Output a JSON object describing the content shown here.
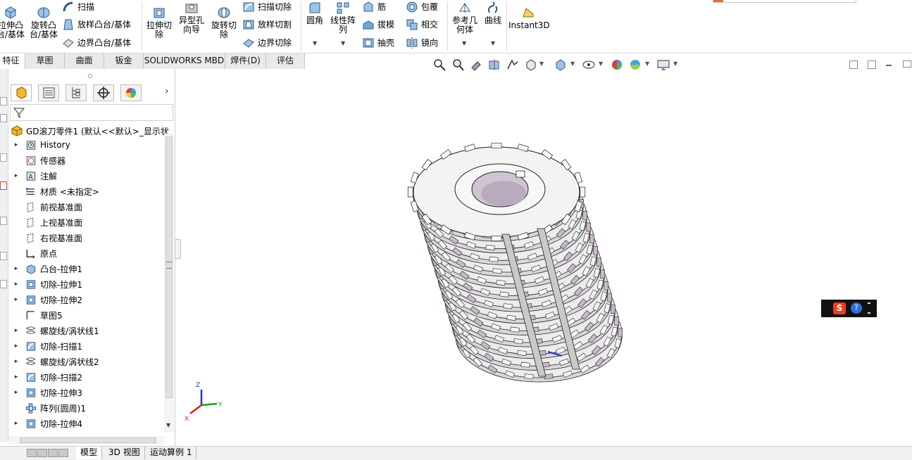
{
  "ribbon": {
    "extrude_boss": "拉伸凸\n台/基体",
    "revolve_boss": "旋转凸\n台/基体",
    "sweep": "扫描",
    "loft_boss": "放样凸台/基体",
    "boundary_boss": "边界凸台/基体",
    "extrude_cut": "拉伸切\n除",
    "hole_wizard": "异型孔\n向导",
    "revolve_cut": "旋转切\n除",
    "swept_cut": "扫描切除",
    "lofted_cut": "放样切割",
    "boundary_cut": "边界切除",
    "fillet": "圆角",
    "linear_pattern": "线性阵\n列",
    "rib": "筋",
    "draft": "拔模",
    "shell": "抽壳",
    "wrap": "包覆",
    "intersect": "相交",
    "mirror": "镜向",
    "ref_geometry": "参考几\n何体",
    "curves": "曲线",
    "instant3d": "Instant3D"
  },
  "tabs": [
    "特征",
    "草图",
    "曲面",
    "钣金",
    "SOLIDWORKS MBD",
    "焊件(D)",
    "评估"
  ],
  "tree": {
    "root": "GD滚刀零件1  (默认<<默认>_显示状",
    "items": [
      {
        "label": "History",
        "arrow": "▸",
        "icon": "history-icon"
      },
      {
        "label": "传感器",
        "arrow": "",
        "icon": "sensor-icon"
      },
      {
        "label": "注解",
        "arrow": "▸",
        "icon": "annotation-icon"
      },
      {
        "label": "材质 <未指定>",
        "arrow": "",
        "icon": "material-icon"
      },
      {
        "label": "前视基准面",
        "arrow": "",
        "icon": "plane-icon"
      },
      {
        "label": "上视基准面",
        "arrow": "",
        "icon": "plane-icon"
      },
      {
        "label": "右视基准面",
        "arrow": "",
        "icon": "plane-icon"
      },
      {
        "label": "原点",
        "arrow": "",
        "icon": "origin-icon"
      },
      {
        "label": "凸台-拉伸1",
        "arrow": "▸",
        "icon": "extrude-icon"
      },
      {
        "label": "切除-拉伸1",
        "arrow": "▸",
        "icon": "cut-extrude-icon"
      },
      {
        "label": "切除-拉伸2",
        "arrow": "▸",
        "icon": "cut-extrude-icon"
      },
      {
        "label": "草图5",
        "arrow": "",
        "icon": "sketch-icon"
      },
      {
        "label": "螺旋线/涡状线1",
        "arrow": "▸",
        "icon": "helix-icon"
      },
      {
        "label": "切除-扫描1",
        "arrow": "▸",
        "icon": "cut-sweep-icon"
      },
      {
        "label": "螺旋线/涡状线2",
        "arrow": "▸",
        "icon": "helix-icon"
      },
      {
        "label": "切除-扫描2",
        "arrow": "▸",
        "icon": "cut-sweep-icon"
      },
      {
        "label": "切除-拉伸3",
        "arrow": "▸",
        "icon": "cut-extrude-icon"
      },
      {
        "label": "阵列(圆周)1",
        "arrow": "",
        "icon": "circular-pattern-icon"
      },
      {
        "label": "切除-拉伸4",
        "arrow": "▸",
        "icon": "cut-extrude-icon"
      }
    ]
  },
  "bottom_tabs": [
    "模型",
    "3D 视图",
    "运动算例 1"
  ],
  "triad": {
    "x": "X",
    "y": "Y",
    "z": "Z"
  },
  "colors": {
    "part_face": "#ececec",
    "part_edge": "#222222",
    "bore": "#cfc4d2",
    "tooth_side": "#c9b8cc",
    "triad_x": "#d81e1e",
    "triad_y": "#1aa01a",
    "triad_z": "#2036c8"
  }
}
